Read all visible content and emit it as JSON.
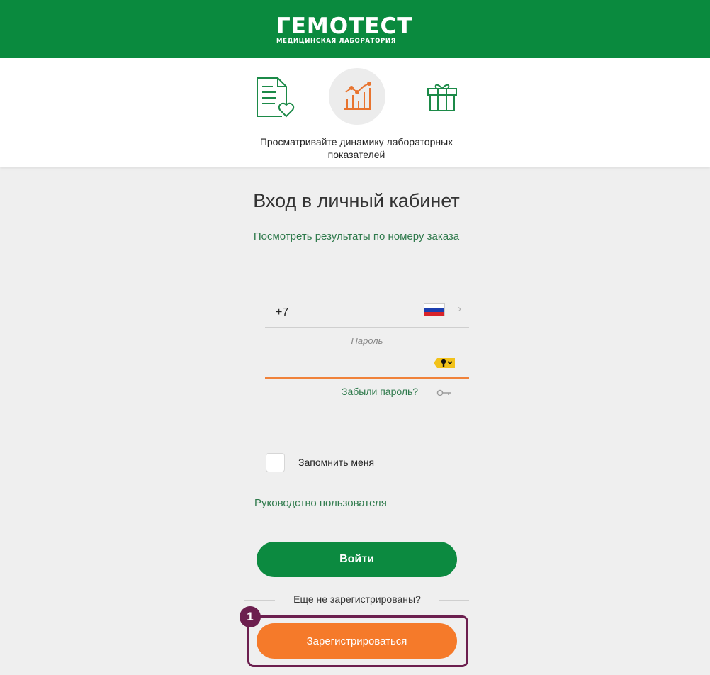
{
  "header": {
    "logo_main": "ГЕМОТЕСТ",
    "logo_sub": "МЕДИЦИНСКАЯ ЛАБОРАТОРИЯ"
  },
  "features": {
    "icons": [
      "document-heart-icon",
      "chart-icon",
      "gift-icon"
    ],
    "active_icon": "chart-icon",
    "caption": "Просматривайте динамику лабораторных показателей"
  },
  "login": {
    "title": "Вход в личный кабинет",
    "results_link": "Посмотреть результаты по номеру заказа",
    "phone_prefix": "+7",
    "country_flag": "russia-flag-icon",
    "password_label": "Пароль",
    "password_value": "",
    "forgot_link": "Забыли пароль?",
    "remember_label": "Запомнить меня",
    "remember_checked": false,
    "guide_link": "Руководство пользователя",
    "login_button": "Войти",
    "not_registered": "Еще не зарегистрированы?",
    "register_button": "Зарегистрироваться",
    "step_marker": "1"
  },
  "colors": {
    "brand_green": "#0a8a3e",
    "link_green": "#2f7a4c",
    "accent_orange": "#f57a2a",
    "highlight_purple": "#6c1f4f",
    "background": "#efefef"
  }
}
